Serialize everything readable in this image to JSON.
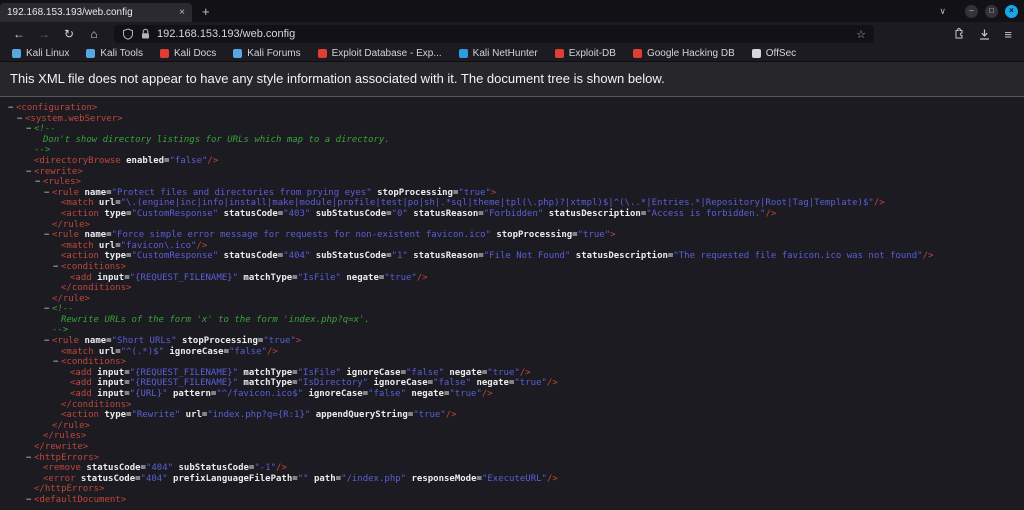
{
  "icons": {
    "back": "←",
    "forward": "→",
    "reload": "↻",
    "home": "⌂",
    "star": "☆",
    "menu": "≡",
    "list_tabs": "∨",
    "new_tab": "+",
    "tab_close": "×",
    "window_minimize": "–",
    "window_maximize": "□",
    "window_close": "×",
    "collapse": "−"
  },
  "window": {
    "tab_title": "192.168.153.193/web.config",
    "url": "192.168.153.193/web.config"
  },
  "bookmarks": [
    {
      "label": "Kali Linux",
      "color": "#57a8e2"
    },
    {
      "label": "Kali Tools",
      "color": "#57a8e2"
    },
    {
      "label": "Kali Docs",
      "color": "#e23d32"
    },
    {
      "label": "Kali Forums",
      "color": "#57a8e2"
    },
    {
      "label": "Exploit Database - Exp...",
      "color": "#e23d32"
    },
    {
      "label": "Kali NetHunter",
      "color": "#2f9be0"
    },
    {
      "label": "Exploit-DB",
      "color": "#e23d32"
    },
    {
      "label": "Google Hacking DB",
      "color": "#e23d32"
    },
    {
      "label": "OffSec",
      "color": "#d8d8dc"
    }
  ],
  "notice": "This XML file does not appear to have any style information associated with it. The document tree is shown below.",
  "colors": {
    "tag": "#c0473c",
    "attr": "#ececf0",
    "value": "#5a5fd8",
    "comment": "#3aa33a",
    "accent": "#18a6e8"
  },
  "xml": {
    "lines": [
      {
        "i": 0,
        "m": 1,
        "p": [
          [
            "t",
            "<configuration>"
          ]
        ]
      },
      {
        "i": 1,
        "m": 1,
        "p": [
          [
            "t",
            "<system.webServer>"
          ]
        ]
      },
      {
        "i": 2,
        "m": 1,
        "p": [
          [
            "c",
            "<!--"
          ]
        ]
      },
      {
        "i": 3,
        "m": 0,
        "p": [
          [
            "c",
            "Don't show directory listings for URLs which map to a directory."
          ]
        ]
      },
      {
        "i": 2,
        "m": 0,
        "p": [
          [
            "c",
            "-->"
          ]
        ]
      },
      {
        "i": 2,
        "m": 0,
        "p": [
          [
            "t",
            "<directoryBrowse"
          ],
          [
            "a",
            " enabled="
          ],
          [
            "v",
            "\"false\""
          ],
          [
            "t",
            "/>"
          ]
        ]
      },
      {
        "i": 2,
        "m": 1,
        "p": [
          [
            "t",
            "<rewrite>"
          ]
        ]
      },
      {
        "i": 3,
        "m": 1,
        "p": [
          [
            "t",
            "<rules>"
          ]
        ]
      },
      {
        "i": 4,
        "m": 1,
        "p": [
          [
            "t",
            "<rule"
          ],
          [
            "a",
            " name="
          ],
          [
            "v",
            "\"Protect files and directories from prying eyes\""
          ],
          [
            "a",
            " stopProcessing="
          ],
          [
            "v",
            "\"true\""
          ],
          [
            "t",
            ">"
          ]
        ]
      },
      {
        "i": 5,
        "m": 0,
        "p": [
          [
            "t",
            "<match"
          ],
          [
            "a",
            " url="
          ],
          [
            "v",
            "\"\\.(engine|inc|info|install|make|module|profile|test|po|sh|.*sql|theme|tpl(\\.php)?|xtmpl)$|^(\\..*|Entries.*|Repository|Root|Tag|Template)$\""
          ],
          [
            "t",
            "/>"
          ]
        ]
      },
      {
        "i": 5,
        "m": 0,
        "p": [
          [
            "t",
            "<action"
          ],
          [
            "a",
            " type="
          ],
          [
            "v",
            "\"CustomResponse\""
          ],
          [
            "a",
            " statusCode="
          ],
          [
            "v",
            "\"403\""
          ],
          [
            "a",
            " subStatusCode="
          ],
          [
            "v",
            "\"0\""
          ],
          [
            "a",
            " statusReason="
          ],
          [
            "v",
            "\"Forbidden\""
          ],
          [
            "a",
            " statusDescription="
          ],
          [
            "v",
            "\"Access is forbidden.\""
          ],
          [
            "t",
            "/>"
          ]
        ]
      },
      {
        "i": 4,
        "m": 0,
        "p": [
          [
            "t",
            "</rule>"
          ]
        ]
      },
      {
        "i": 4,
        "m": 1,
        "p": [
          [
            "t",
            "<rule"
          ],
          [
            "a",
            " name="
          ],
          [
            "v",
            "\"Force simple error message for requests for non-existent favicon.ico\""
          ],
          [
            "a",
            " stopProcessing="
          ],
          [
            "v",
            "\"true\""
          ],
          [
            "t",
            ">"
          ]
        ]
      },
      {
        "i": 5,
        "m": 0,
        "p": [
          [
            "t",
            "<match"
          ],
          [
            "a",
            " url="
          ],
          [
            "v",
            "\"favicon\\.ico\""
          ],
          [
            "t",
            "/>"
          ]
        ]
      },
      {
        "i": 5,
        "m": 0,
        "p": [
          [
            "t",
            "<action"
          ],
          [
            "a",
            " type="
          ],
          [
            "v",
            "\"CustomResponse\""
          ],
          [
            "a",
            " statusCode="
          ],
          [
            "v",
            "\"404\""
          ],
          [
            "a",
            " subStatusCode="
          ],
          [
            "v",
            "\"1\""
          ],
          [
            "a",
            " statusReason="
          ],
          [
            "v",
            "\"File Not Found\""
          ],
          [
            "a",
            " statusDescription="
          ],
          [
            "v",
            "\"The requested file favicon.ico was not found\""
          ],
          [
            "t",
            "/>"
          ]
        ]
      },
      {
        "i": 5,
        "m": 1,
        "p": [
          [
            "t",
            "<conditions>"
          ]
        ]
      },
      {
        "i": 6,
        "m": 0,
        "p": [
          [
            "t",
            "<add"
          ],
          [
            "a",
            " input="
          ],
          [
            "v",
            "\"{REQUEST_FILENAME}\""
          ],
          [
            "a",
            " matchType="
          ],
          [
            "v",
            "\"IsFile\""
          ],
          [
            "a",
            " negate="
          ],
          [
            "v",
            "\"true\""
          ],
          [
            "t",
            "/>"
          ]
        ]
      },
      {
        "i": 5,
        "m": 0,
        "p": [
          [
            "t",
            "</conditions>"
          ]
        ]
      },
      {
        "i": 4,
        "m": 0,
        "p": [
          [
            "t",
            "</rule>"
          ]
        ]
      },
      {
        "i": 4,
        "m": 1,
        "p": [
          [
            "c",
            "<!--"
          ]
        ]
      },
      {
        "i": 5,
        "m": 0,
        "p": [
          [
            "c",
            "Rewrite URLs of the form 'x' to the form 'index.php?q=x'."
          ]
        ]
      },
      {
        "i": 4,
        "m": 0,
        "p": [
          [
            "c",
            "-->"
          ]
        ]
      },
      {
        "i": 4,
        "m": 1,
        "p": [
          [
            "t",
            "<rule"
          ],
          [
            "a",
            " name="
          ],
          [
            "v",
            "\"Short URLs\""
          ],
          [
            "a",
            " stopProcessing="
          ],
          [
            "v",
            "\"true\""
          ],
          [
            "t",
            ">"
          ]
        ]
      },
      {
        "i": 5,
        "m": 0,
        "p": [
          [
            "t",
            "<match"
          ],
          [
            "a",
            " url="
          ],
          [
            "v",
            "\"^(.*)$\""
          ],
          [
            "a",
            " ignoreCase="
          ],
          [
            "v",
            "\"false\""
          ],
          [
            "t",
            "/>"
          ]
        ]
      },
      {
        "i": 5,
        "m": 1,
        "p": [
          [
            "t",
            "<conditions>"
          ]
        ]
      },
      {
        "i": 6,
        "m": 0,
        "p": [
          [
            "t",
            "<add"
          ],
          [
            "a",
            " input="
          ],
          [
            "v",
            "\"{REQUEST_FILENAME}\""
          ],
          [
            "a",
            " matchType="
          ],
          [
            "v",
            "\"IsFile\""
          ],
          [
            "a",
            " ignoreCase="
          ],
          [
            "v",
            "\"false\""
          ],
          [
            "a",
            " negate="
          ],
          [
            "v",
            "\"true\""
          ],
          [
            "t",
            "/>"
          ]
        ]
      },
      {
        "i": 6,
        "m": 0,
        "p": [
          [
            "t",
            "<add"
          ],
          [
            "a",
            " input="
          ],
          [
            "v",
            "\"{REQUEST_FILENAME}\""
          ],
          [
            "a",
            " matchType="
          ],
          [
            "v",
            "\"IsDirectory\""
          ],
          [
            "a",
            " ignoreCase="
          ],
          [
            "v",
            "\"false\""
          ],
          [
            "a",
            " negate="
          ],
          [
            "v",
            "\"true\""
          ],
          [
            "t",
            "/>"
          ]
        ]
      },
      {
        "i": 6,
        "m": 0,
        "p": [
          [
            "t",
            "<add"
          ],
          [
            "a",
            " input="
          ],
          [
            "v",
            "\"{URL}\""
          ],
          [
            "a",
            " pattern="
          ],
          [
            "v",
            "\"^/favicon.ico$\""
          ],
          [
            "a",
            " ignoreCase="
          ],
          [
            "v",
            "\"false\""
          ],
          [
            "a",
            " negate="
          ],
          [
            "v",
            "\"true\""
          ],
          [
            "t",
            "/>"
          ]
        ]
      },
      {
        "i": 5,
        "m": 0,
        "p": [
          [
            "t",
            "</conditions>"
          ]
        ]
      },
      {
        "i": 5,
        "m": 0,
        "p": [
          [
            "t",
            "<action"
          ],
          [
            "a",
            " type="
          ],
          [
            "v",
            "\"Rewrite\""
          ],
          [
            "a",
            " url="
          ],
          [
            "v",
            "\"index.php?q={R:1}\""
          ],
          [
            "a",
            " appendQueryString="
          ],
          [
            "v",
            "\"true\""
          ],
          [
            "t",
            "/>"
          ]
        ]
      },
      {
        "i": 4,
        "m": 0,
        "p": [
          [
            "t",
            "</rule>"
          ]
        ]
      },
      {
        "i": 3,
        "m": 0,
        "p": [
          [
            "t",
            "</rules>"
          ]
        ]
      },
      {
        "i": 2,
        "m": 0,
        "p": [
          [
            "t",
            "</rewrite>"
          ]
        ]
      },
      {
        "i": 2,
        "m": 1,
        "p": [
          [
            "t",
            "<httpErrors>"
          ]
        ]
      },
      {
        "i": 3,
        "m": 0,
        "p": [
          [
            "t",
            "<remove"
          ],
          [
            "a",
            " statusCode="
          ],
          [
            "v",
            "\"404\""
          ],
          [
            "a",
            " subStatusCode="
          ],
          [
            "v",
            "\"-1\""
          ],
          [
            "t",
            "/>"
          ]
        ]
      },
      {
        "i": 3,
        "m": 0,
        "p": [
          [
            "t",
            "<error"
          ],
          [
            "a",
            " statusCode="
          ],
          [
            "v",
            "\"404\""
          ],
          [
            "a",
            " prefixLanguageFilePath="
          ],
          [
            "v",
            "\"\""
          ],
          [
            "a",
            " path="
          ],
          [
            "v",
            "\"/index.php\""
          ],
          [
            "a",
            " responseMode="
          ],
          [
            "v",
            "\"ExecuteURL\""
          ],
          [
            "t",
            "/>"
          ]
        ]
      },
      {
        "i": 2,
        "m": 0,
        "p": [
          [
            "t",
            "</httpErrors>"
          ]
        ]
      },
      {
        "i": 2,
        "m": 1,
        "p": [
          [
            "t",
            "<defaultDocument>"
          ]
        ]
      }
    ]
  }
}
